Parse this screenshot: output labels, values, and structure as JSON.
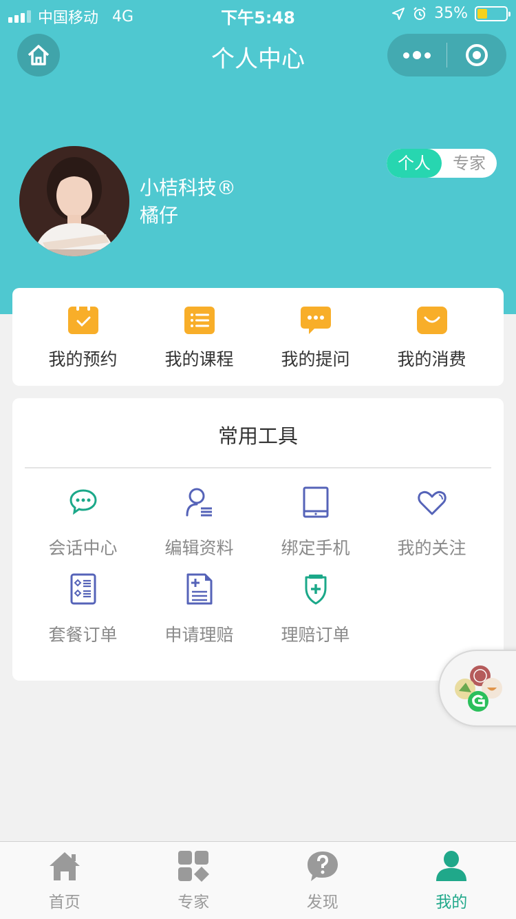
{
  "status_bar": {
    "carrier": "中国移动",
    "network": "4G",
    "time": "下午5:48",
    "battery": "35%",
    "battery_level": 0.35
  },
  "nav": {
    "title": "个人中心",
    "home_icon": "home-icon",
    "more_icon": "more-dots-icon",
    "close_icon": "target-icon"
  },
  "profile": {
    "username": "小桔科技®",
    "nickname": "橘仔",
    "role_options": [
      "个人",
      "专家"
    ],
    "active_role": "个人"
  },
  "quick_actions": [
    {
      "label": "我的预约",
      "icon": "calendar-check-icon"
    },
    {
      "label": "我的课程",
      "icon": "list-icon"
    },
    {
      "label": "我的提问",
      "icon": "chat-bubble-icon"
    },
    {
      "label": "我的消费",
      "icon": "smile-icon"
    }
  ],
  "tools": {
    "title": "常用工具",
    "items": [
      {
        "label": "会话中心",
        "icon": "chat-icon"
      },
      {
        "label": "编辑资料",
        "icon": "user-edit-icon"
      },
      {
        "label": "绑定手机",
        "icon": "tablet-icon"
      },
      {
        "label": "我的关注",
        "icon": "heart-icon"
      },
      {
        "label": "套餐订单",
        "icon": "package-list-icon"
      },
      {
        "label": "申请理赔",
        "icon": "claim-document-icon"
      },
      {
        "label": "理赔订单",
        "icon": "shield-plus-icon"
      }
    ]
  },
  "tab_bar": {
    "items": [
      {
        "label": "首页",
        "icon": "home-icon"
      },
      {
        "label": "专家",
        "icon": "grid-icon"
      },
      {
        "label": "发现",
        "icon": "question-icon"
      },
      {
        "label": "我的",
        "icon": "person-icon"
      }
    ],
    "active": "我的"
  },
  "colors": {
    "header": "#4fc8d0",
    "accent_orange": "#f8ae29",
    "tool_green": "#1ba889",
    "tool_blue": "#5563b8",
    "tab_active": "#20a88a",
    "toggle_active": "#27d6b0"
  }
}
